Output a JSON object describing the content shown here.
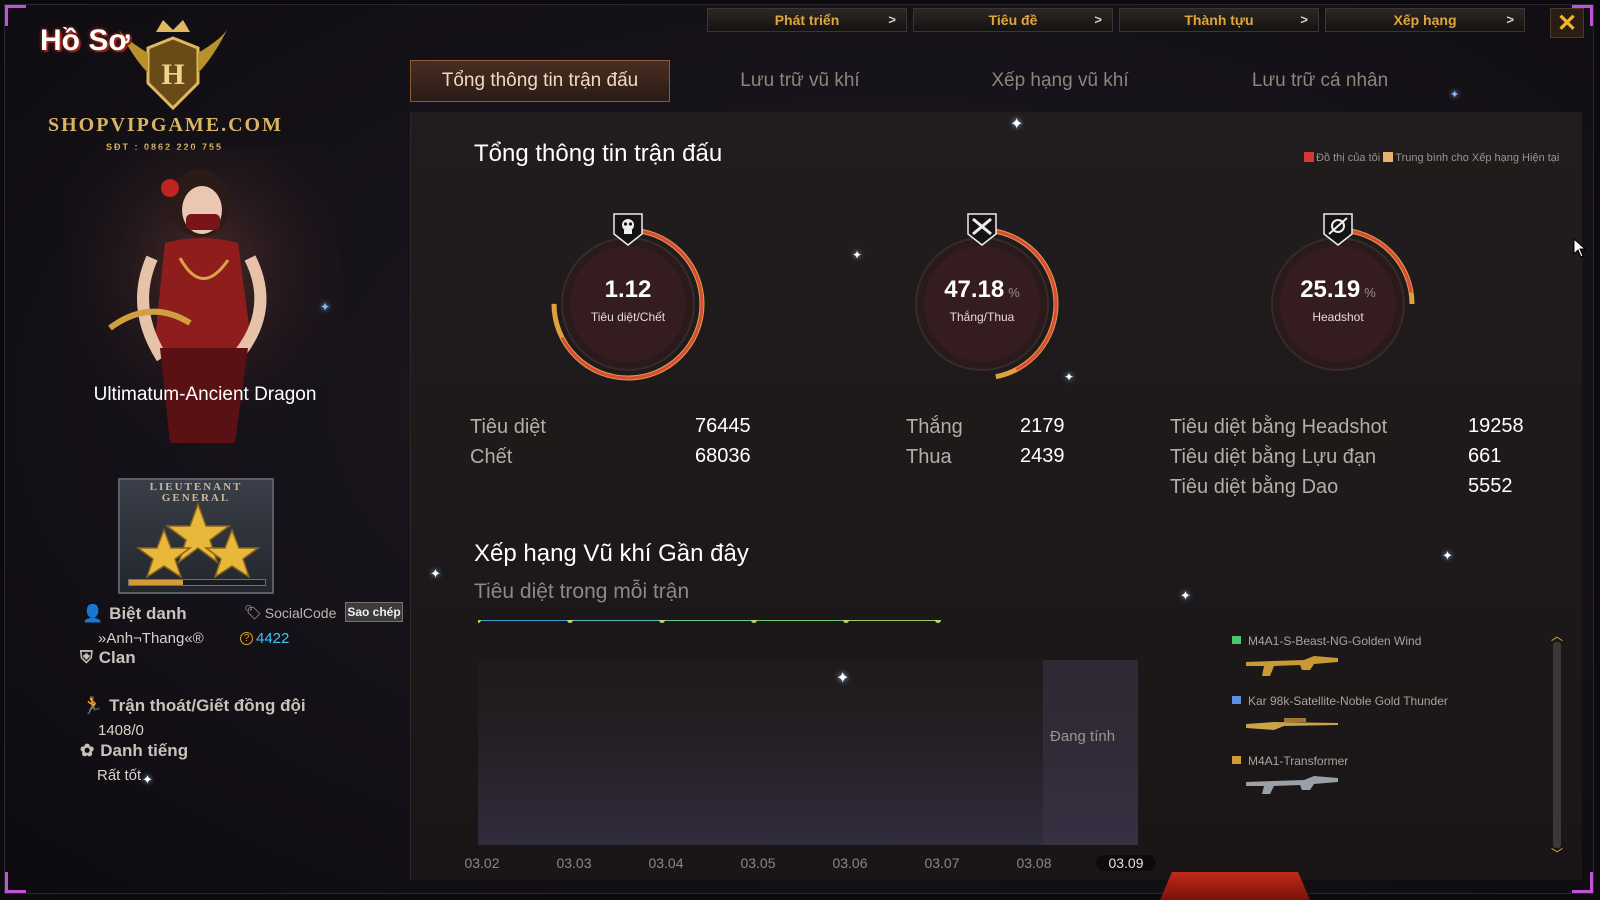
{
  "topnav": [
    {
      "label": "Phát triển",
      "arrow": ">"
    },
    {
      "label": "Tiêu đề",
      "arrow": ">"
    },
    {
      "label": "Thành tựu",
      "arrow": ">"
    },
    {
      "label": "Xếp hạng",
      "arrow": ">"
    }
  ],
  "close_label": "✕",
  "logo": {
    "hoso": "Hồ Sơ",
    "shop": "SHOPVIPGAME.COM",
    "phone": "SĐT : 0862 220 755"
  },
  "tabs": [
    "Tổng thông tin trận đấu",
    "Lưu trữ vũ khí",
    "Xếp hạng vũ khí",
    "Lưu trữ cá nhân"
  ],
  "character": {
    "name": "Ultimatum-Ancient Dragon",
    "rank_text": "LIEUTENANT GENERAL",
    "rank_progress": 0.4
  },
  "profile": {
    "nickname_label": "Biệt danh",
    "nickname": "»Anh¬Thang«®",
    "socialcode_label": "SocialCode",
    "copy_button": "Sao chép",
    "coin_value": "4422",
    "clan_label": "Clan",
    "escape_label": "Trận thoát/Giết đồng đội",
    "escape_value": "1408/0",
    "reputation_label": "Danh tiếng",
    "reputation_value": "Rất tốt"
  },
  "summary": {
    "title": "Tổng thông tin trận đấu",
    "legend_mine": "Đồ thị của tôi",
    "legend_avg": "Trung bình cho Xếp hạng Hiện tại",
    "legend_colors": {
      "mine": "#d8353b",
      "avg": "#e7b36a"
    },
    "gauges": [
      {
        "value": "1.12",
        "unit": "",
        "label": "Tiêu diệt/Chết",
        "fill": 0.75,
        "icon": "skull-icon"
      },
      {
        "value": "47.18",
        "unit": "%",
        "label": "Thắng/Thua",
        "fill": 0.47,
        "icon": "crossed-guns-icon"
      },
      {
        "value": "25.19",
        "unit": "%",
        "label": "Headshot",
        "fill": 0.25,
        "icon": "crosshair-icon"
      }
    ],
    "stats_kd": [
      {
        "label": "Tiêu diệt",
        "value": "76445"
      },
      {
        "label": "Chết",
        "value": "68036"
      }
    ],
    "stats_wl": [
      {
        "label": "Thắng",
        "value": "2179"
      },
      {
        "label": "Thua",
        "value": "2439"
      }
    ],
    "stats_hs": [
      {
        "label": "Tiêu diệt bằng Headshot",
        "value": "19258"
      },
      {
        "label": "Tiêu diệt bằng Lựu đạn",
        "value": "661"
      },
      {
        "label": "Tiêu diệt bằng Dao",
        "value": "5552"
      }
    ]
  },
  "recent": {
    "title": "Xếp hạng Vũ khí Gần đây",
    "subtitle": "Tiêu diệt trong mỗi trận",
    "calculating": "Đang tính",
    "weapons": [
      {
        "name": "M4A1-S-Beast-NG-Golden Wind",
        "color": "#4fc46a"
      },
      {
        "name": "Kar 98k-Satellite-Noble Gold Thunder",
        "color": "#5b8fe0"
      },
      {
        "name": "M4A1-Transformer",
        "color": "#d49a3a"
      }
    ]
  },
  "chart_data": {
    "type": "line",
    "categories": [
      "03.02",
      "03.03",
      "03.04",
      "03.05",
      "03.06",
      "03.07",
      "03.08",
      "03.09"
    ],
    "selected_category": "03.09",
    "series": [
      {
        "values": [
          0,
          0,
          0,
          0,
          0,
          0
        ]
      }
    ]
  }
}
